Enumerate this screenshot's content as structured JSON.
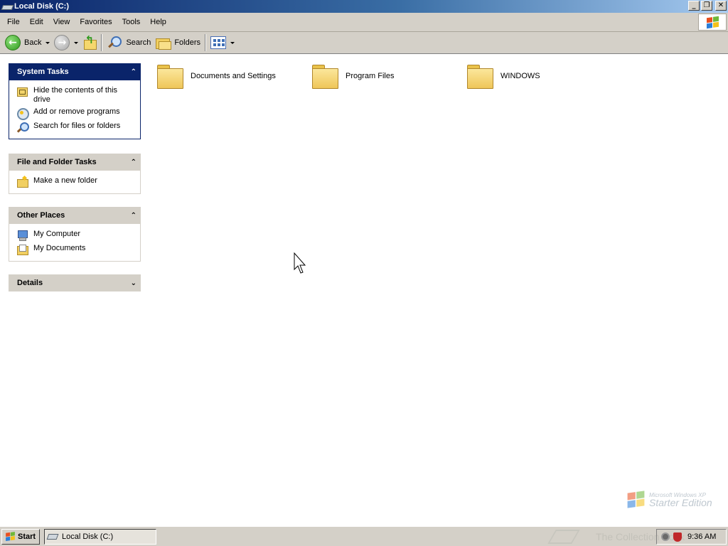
{
  "window": {
    "title": "Local Disk (C:)",
    "minimize_glyph": "_",
    "restore_glyph": "❐",
    "close_glyph": "✕"
  },
  "menu": [
    "File",
    "Edit",
    "View",
    "Favorites",
    "Tools",
    "Help"
  ],
  "toolbar": {
    "back_label": "Back",
    "search_label": "Search",
    "folders_label": "Folders"
  },
  "task_panes": {
    "system_tasks": {
      "title": "System Tasks",
      "items": [
        "Hide the contents of this drive",
        "Add or remove programs",
        "Search for files or folders"
      ]
    },
    "file_folder_tasks": {
      "title": "File and Folder Tasks",
      "items": [
        "Make a new folder"
      ]
    },
    "other_places": {
      "title": "Other Places",
      "items": [
        "My Computer",
        "My Documents"
      ]
    },
    "details": {
      "title": "Details"
    }
  },
  "folders": [
    "Documents and Settings",
    "Program Files",
    "WINDOWS"
  ],
  "watermark": {
    "line1": "Microsoft Windows XP",
    "line2": "Starter Edition"
  },
  "taskbar": {
    "start_label": "Start",
    "task_label": "Local Disk (C:)",
    "watermark_text": "The Collection Book",
    "clock": "9:36 AM"
  },
  "colors": {
    "title_bar": "#0a246a",
    "chrome": "#d4d0c8",
    "panel_header_active": "#0a246a",
    "folder_yellow": "#efc659"
  }
}
